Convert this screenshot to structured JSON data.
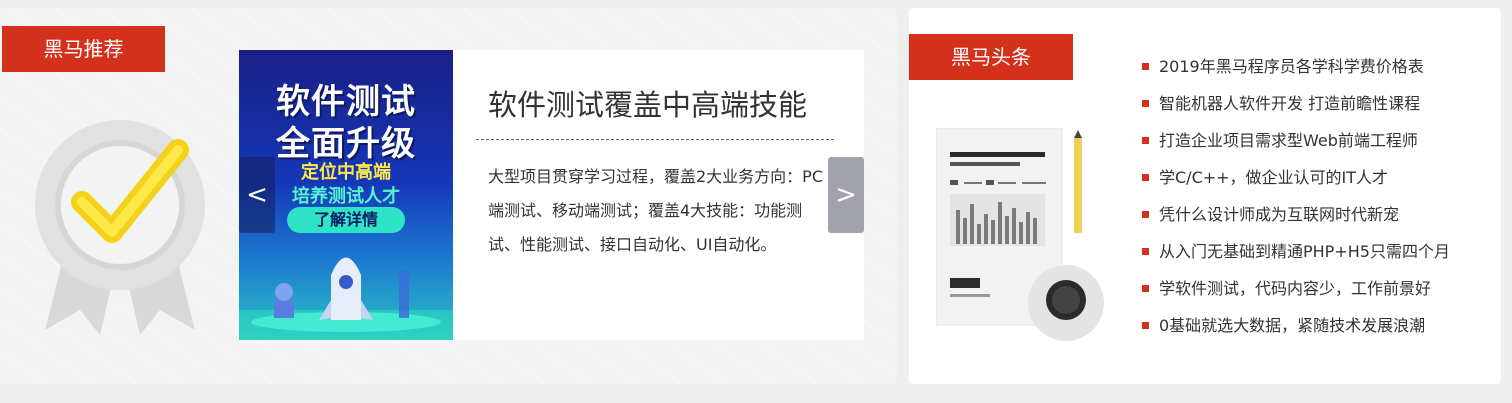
{
  "left_panel": {
    "tag_label": "黑马推荐",
    "carousel": {
      "banner": {
        "title_line1": "软件测试",
        "title_line2": "全面升级",
        "subtitle_line1": "定位中高端",
        "subtitle_line2": "培养测试人才",
        "cta_label": "了解详情"
      },
      "headline": "软件测试覆盖中高端技能",
      "description": "大型项目贯穿学习过程，覆盖2大业务方向：PC端测试、移动端测试；覆盖4大技能：功能测试、性能测试、接口自动化、UI自动化。",
      "prev_label": "<",
      "next_label": ">"
    }
  },
  "right_panel": {
    "tag_label": "黑马头条",
    "news": [
      "2019年黑马程序员各学科学费价格表",
      "智能机器人软件开发 打造前瞻性课程",
      "打造企业项目需求型Web前端工程师",
      "学C/C++，做企业认可的IT人才",
      "凭什么设计师成为互联网时代新宠",
      "从入门无基础到精通PHP+H5只需四个月",
      "学软件测试，代码内容少，工作前景好",
      "0基础就选大数据，紧随技术发展浪潮"
    ]
  },
  "colors": {
    "accent_red": "#d4311c",
    "banner_blue": "#1536b8",
    "cta_teal": "#2fe3c6",
    "arrow_gray": "#a2a2aa"
  },
  "icons": [
    "checkmark-badge-icon",
    "document-magnifier-icon",
    "pencil-icon"
  ]
}
